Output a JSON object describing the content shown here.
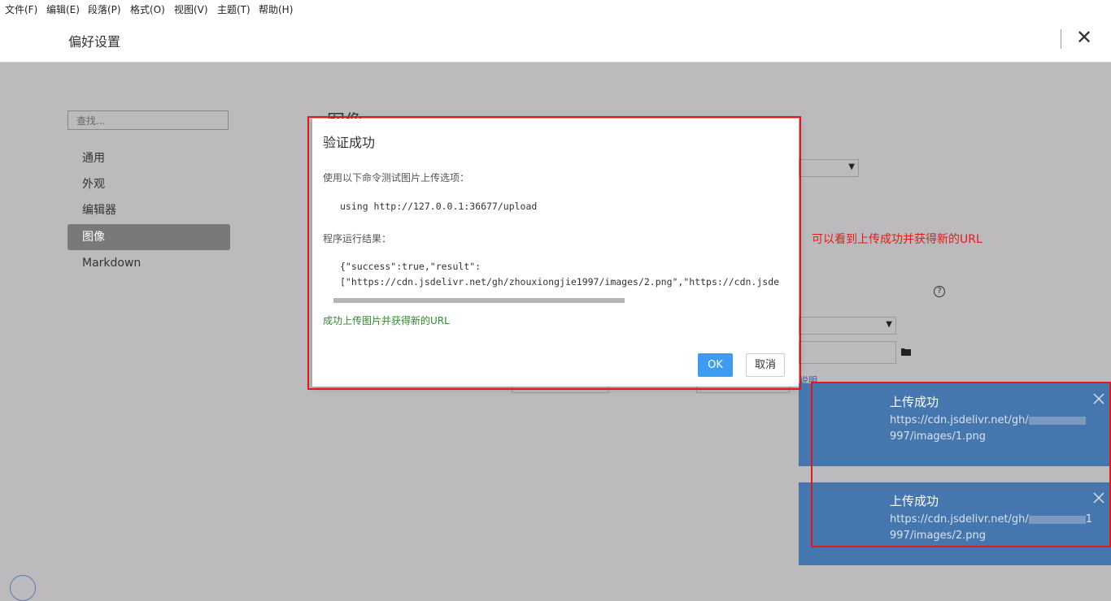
{
  "menu": [
    "文件(F)",
    "编辑(E)",
    "段落(P)",
    "格式(O)",
    "视图(V)",
    "主题(T)",
    "帮助(H)"
  ],
  "header": {
    "title": "偏好设置"
  },
  "sidebar": {
    "search_placeholder": "查找...",
    "items": [
      {
        "label": "通用"
      },
      {
        "label": "外观"
      },
      {
        "label": "编辑器"
      },
      {
        "label": "图像"
      },
      {
        "label": "Markdown"
      }
    ]
  },
  "background": {
    "heading": "图像",
    "link_fragment": "说明"
  },
  "annotation": "可以看到上传成功并获得新的URL",
  "dialog": {
    "title": "验证成功",
    "command_label": "使用以下命令测试图片上传选项：",
    "command": "using http://127.0.0.1:36677/upload",
    "result_label": "程序运行结果：",
    "result_line1": "{\"success\":true,\"result\":",
    "result_line2": "[\"https://cdn.jsdelivr.net/gh/zhouxiongjie1997/images/2.png\",\"https://cdn.jsde",
    "success_message": "成功上传图片并获得新的URL",
    "ok_label": "OK",
    "cancel_label": "取消"
  },
  "toasts": [
    {
      "title": "上传成功",
      "url_prefix": "https://cdn.jsdelivr.net/gh/",
      "url_suffix": "997/images/1.png"
    },
    {
      "title": "上传成功",
      "url_prefix": "https://cdn.jsdelivr.net/gh/",
      "url_mid": "1",
      "url_suffix": "997/images/2.png"
    }
  ],
  "colors": {
    "accent": "#3d9bf0",
    "toast": "#4676ae",
    "annotation": "#e01b1b",
    "success": "#2e8b2e",
    "overlay": "#bcbabd"
  }
}
